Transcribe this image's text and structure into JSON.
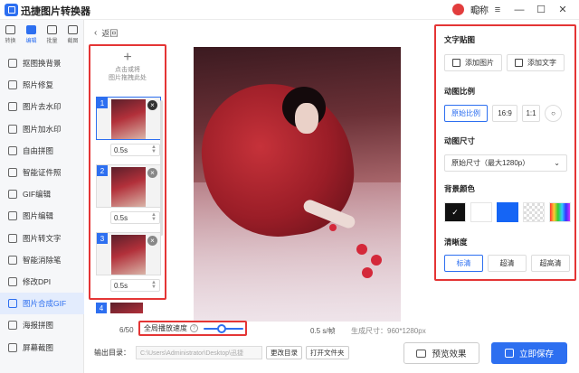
{
  "app": {
    "title": "迅捷图片转换器",
    "user_name": "昵称"
  },
  "window_controls": [
    "⬡",
    "≡",
    "—",
    "☐",
    "✕"
  ],
  "sidebar": {
    "tabs": [
      {
        "label": "转换",
        "icon": "convert-icon",
        "active": false
      },
      {
        "label": "编辑",
        "icon": "edit-icon",
        "active": true
      },
      {
        "label": "批量",
        "icon": "batch-icon",
        "active": false
      },
      {
        "label": "截图",
        "icon": "screenshot-icon",
        "active": false
      }
    ],
    "items": [
      {
        "label": "抠图换背景",
        "active": false
      },
      {
        "label": "照片修复",
        "active": false
      },
      {
        "label": "图片去水印",
        "active": false
      },
      {
        "label": "图片加水印",
        "active": false
      },
      {
        "label": "自由拼图",
        "active": false
      },
      {
        "label": "智能证件照",
        "active": false
      },
      {
        "label": "GIF编辑",
        "active": false
      },
      {
        "label": "图片编辑",
        "active": false
      },
      {
        "label": "图片转文字",
        "active": false
      },
      {
        "label": "智能消除笔",
        "active": false
      },
      {
        "label": "修改DPI",
        "active": false
      },
      {
        "label": "图片合成GIF",
        "active": true
      },
      {
        "label": "海报拼图",
        "active": false
      },
      {
        "label": "屏幕截图",
        "active": false
      }
    ]
  },
  "back": {
    "label": "返回"
  },
  "frames": {
    "add_hint_line1": "点击或将",
    "add_hint_line2": "图片拖拽此处",
    "items": [
      {
        "number": "1",
        "duration": "0.5s",
        "selected": true
      },
      {
        "number": "2",
        "duration": "0.5s",
        "selected": false
      },
      {
        "number": "3",
        "duration": "0.5s",
        "selected": false
      }
    ],
    "peek_number": "4"
  },
  "status": {
    "frame_count": "6/50",
    "speed_label": "全局播放速度",
    "speed_value": "0.5 s/帧",
    "output_size": "生成尺寸：960*1280px",
    "speed_level": 0.45
  },
  "output": {
    "label": "输出目录：",
    "path": "C:\\Users\\Administrator\\Desktop\\迅捷",
    "change_button": "更改目录",
    "open_button": "打开文件夹"
  },
  "actions": {
    "preview": "预览效果",
    "save": "立即保存"
  },
  "settings": {
    "text_sticker": {
      "title": "文字贴图",
      "add_image": "添加图片",
      "add_text": "添加文字"
    },
    "ratio": {
      "title": "动图比例",
      "options": [
        "原始比例",
        "16:9",
        "1:1"
      ],
      "selected": "原始比例"
    },
    "size": {
      "title": "动图尺寸",
      "value": "原始尺寸（最大1280p）"
    },
    "background": {
      "title": "背景颜色",
      "colors": [
        "#111111",
        "#ffffff",
        "#1565f5",
        "transparent",
        "rainbow"
      ],
      "selected": "#111111"
    },
    "clarity": {
      "title": "清晰度",
      "options": [
        "标清",
        "超清",
        "超高清"
      ],
      "selected": "标清"
    }
  },
  "colors": {
    "accent": "#2d6ff0",
    "highlight_border": "#e43535"
  }
}
